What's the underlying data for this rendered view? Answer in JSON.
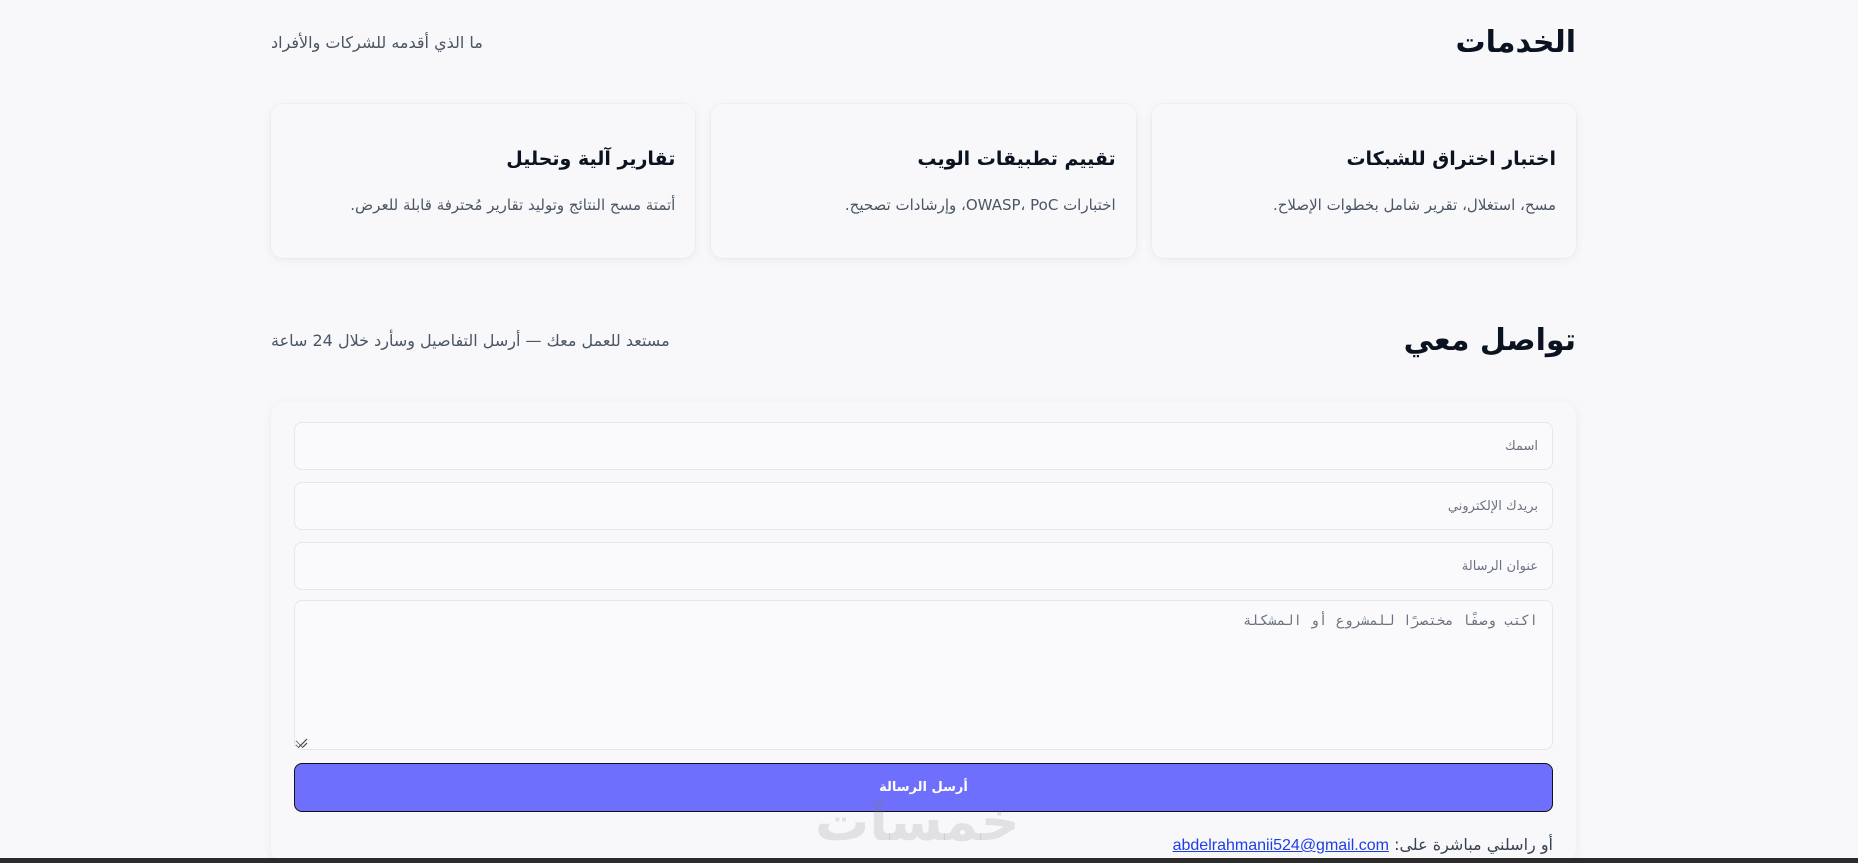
{
  "services": {
    "title": "الخدمات",
    "subtitle": "ما الذي أقدمه للشركات والأفراد",
    "cards": [
      {
        "title": "اختبار اختراق للشبكات",
        "description": "مسح، استغلال، تقرير شامل بخطوات الإصلاح."
      },
      {
        "title": "تقييم تطبيقات الويب",
        "description": "اختبارات OWASP، PoC، وإرشادات تصحيح."
      },
      {
        "title": "تقارير آلية وتحليل",
        "description": "أتمتة مسح النتائج وتوليد تقارير مُحترفة قابلة للعرض."
      }
    ]
  },
  "contact": {
    "title": "تواصل معي",
    "subtitle": "مستعد للعمل معك — أرسل التفاصيل وسأرد خلال 24 ساعة",
    "form": {
      "name_placeholder": "اسمك",
      "email_placeholder": "بريدك الإلكتروني",
      "subject_placeholder": "عنوان الرسالة",
      "message_placeholder": "اكتب وصفًا مختصرًا للمشروع أو المشكلة",
      "submit_label": "أرسل الرسالة"
    },
    "direct_prefix": "أو راسلني مباشرة على:",
    "email": "abdelrahmanii524@gmail.com"
  },
  "watermark": "خمسات",
  "colors": {
    "accent": "#6f6ffd",
    "link": "#1d3ee6",
    "background": "#f8f8fb"
  }
}
